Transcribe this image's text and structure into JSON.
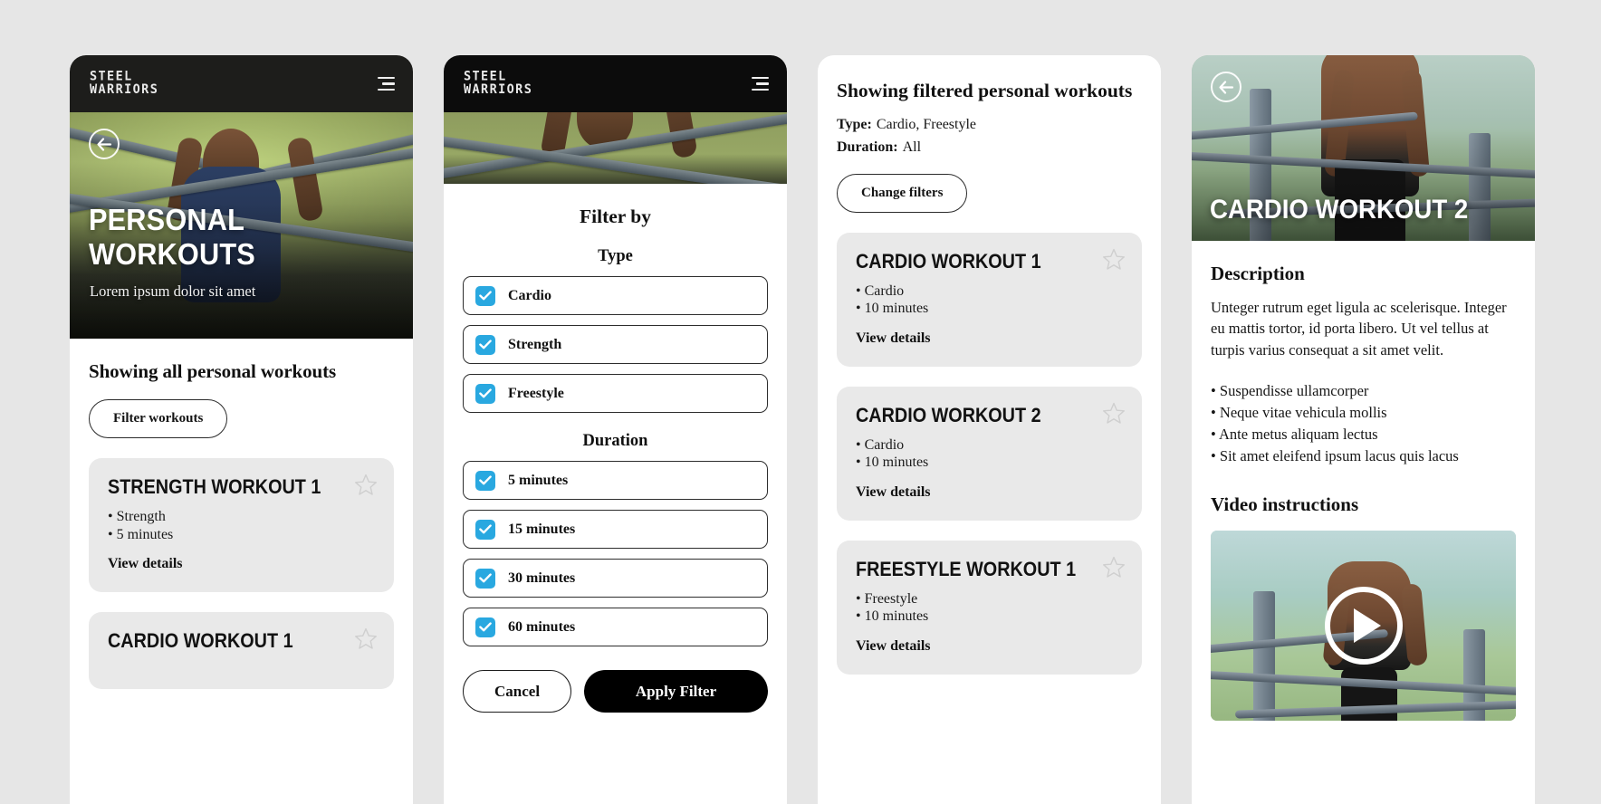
{
  "brand": {
    "line1": "STEEL",
    "line2": "WARRIORS"
  },
  "panel1": {
    "hero": {
      "title": "PERSONAL WORKOUTS",
      "subtitle": "Lorem ipsum dolor sit amet"
    },
    "heading": "Showing all personal workouts",
    "filter_button": "Filter workouts",
    "cards": [
      {
        "title": "STRENGTH WORKOUT 1",
        "meta": [
          "• Strength",
          "• 5 minutes"
        ],
        "link": "View details"
      },
      {
        "title": "CARDIO WORKOUT 1",
        "meta": [],
        "link": ""
      }
    ]
  },
  "panel2": {
    "modal_title": "Filter by",
    "groups": [
      {
        "label": "Type",
        "options": [
          {
            "label": "Cardio",
            "checked": true
          },
          {
            "label": "Strength",
            "checked": true
          },
          {
            "label": "Freestyle",
            "checked": true
          }
        ]
      },
      {
        "label": "Duration",
        "options": [
          {
            "label": "5 minutes",
            "checked": true
          },
          {
            "label": "15 minutes",
            "checked": true
          },
          {
            "label": "30 minutes",
            "checked": true
          },
          {
            "label": "60 minutes",
            "checked": true
          }
        ]
      }
    ],
    "cancel_label": "Cancel",
    "apply_label": "Apply Filter"
  },
  "panel3": {
    "heading": "Showing filtered personal workouts",
    "type_label": "Type:",
    "type_value": "Cardio, Freestyle",
    "duration_label": "Duration:",
    "duration_value": "All",
    "change_button": "Change filters",
    "cards": [
      {
        "title": "CARDIO WORKOUT 1",
        "meta": [
          "• Cardio",
          "• 10 minutes"
        ],
        "link": "View details"
      },
      {
        "title": "CARDIO WORKOUT 2",
        "meta": [
          "• Cardio",
          "• 10 minutes"
        ],
        "link": "View details"
      },
      {
        "title": "FREESTYLE WORKOUT 1",
        "meta": [
          "• Freestyle",
          "• 10 minutes"
        ],
        "link": "View details"
      }
    ]
  },
  "panel4": {
    "hero_title": "CARDIO WORKOUT 2",
    "description_heading": "Description",
    "description_text": "Unteger rutrum eget ligula ac scelerisque. Integer eu mattis tortor, id porta libero. Ut vel tellus at turpis varius consequat a sit amet velit.",
    "bullets": [
      "• Suspendisse ullamcorper",
      "• Neque vitae vehicula mollis",
      "• Ante metus aliquam lectus",
      "• Sit amet eleifend ipsum lacus quis lacus"
    ],
    "video_heading": "Video instructions"
  },
  "colors": {
    "background": "#e6e6e6",
    "appbar": "#1d1d1b",
    "checkbox_blue": "#29a8e0",
    "card_grey": "#e9e9e9",
    "accent_black": "#000000"
  }
}
